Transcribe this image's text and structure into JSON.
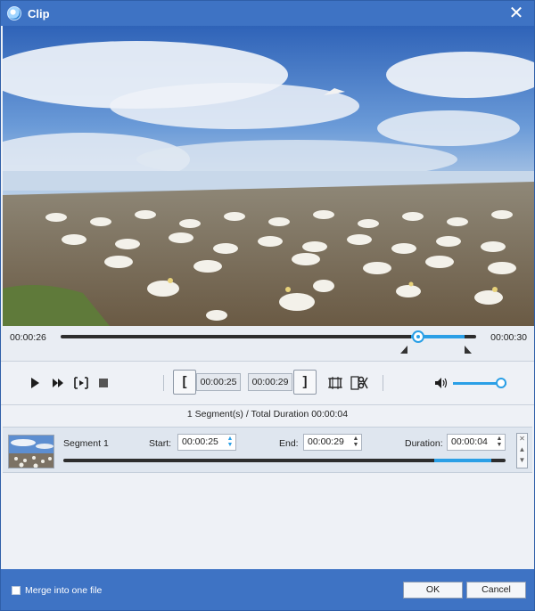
{
  "window": {
    "title": "Clip",
    "icon": "app-logo-icon",
    "close_icon": "close-icon"
  },
  "timeline": {
    "current_time": "00:00:26",
    "total_time": "00:00:30",
    "playhead_progress": 0.86
  },
  "controls": {
    "set_start_label": "[",
    "start_time": "00:00:25",
    "end_time": "00:00:29",
    "set_end_label": "]",
    "volume_level": 0.9
  },
  "summary": "1 Segment(s) / Total Duration 00:00:04",
  "segment": {
    "name": "Segment 1",
    "start_label": "Start:",
    "start_value": "00:00:25",
    "end_label": "End:",
    "end_value": "00:00:29",
    "duration_label": "Duration:",
    "duration_value": "00:00:04"
  },
  "footer": {
    "merge_label": "Merge into one file",
    "ok_label": "OK",
    "cancel_label": "Cancel"
  },
  "colors": {
    "titlebar": "#3e73c4",
    "accent": "#2a9fe6"
  }
}
